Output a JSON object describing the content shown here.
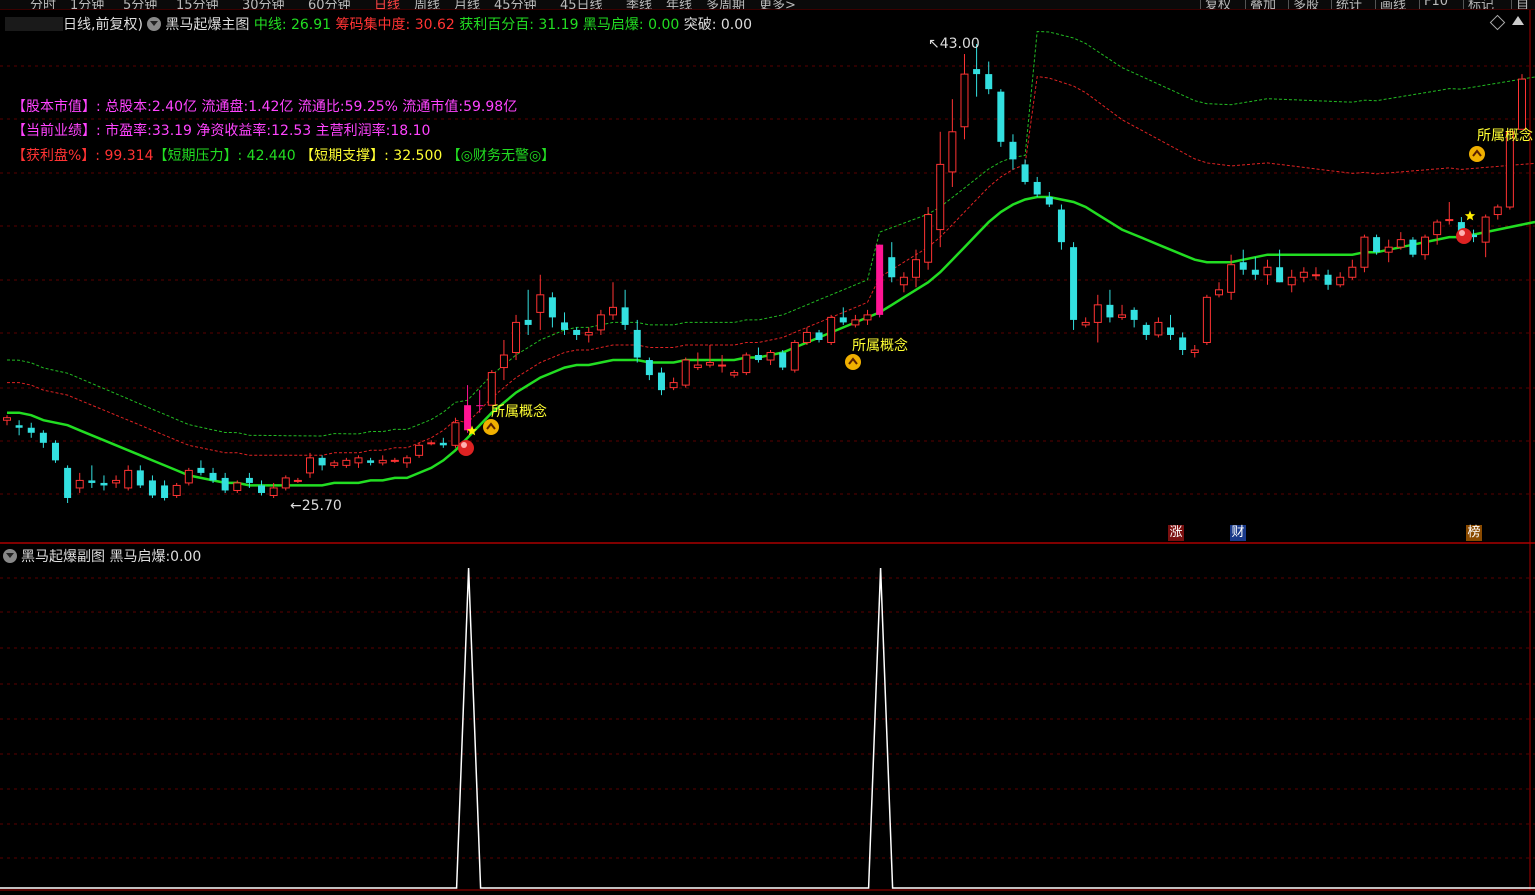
{
  "toolbar": {
    "timeframes": [
      "分时",
      "1分钟",
      "5分钟",
      "15分钟",
      "30分钟",
      "60分钟",
      "日线",
      "周线",
      "月线",
      "45分钟",
      "45日线",
      "季线",
      "年线",
      "多周期",
      "更多>"
    ],
    "active_timeframe": "日线",
    "buttons": [
      "复权",
      "叠加",
      "多股",
      "统计",
      "画线",
      "F10",
      "标记",
      "自"
    ]
  },
  "main_panel": {
    "mode_label": "日线,前复权)",
    "indicator_name": "黑马起爆主图",
    "params": [
      {
        "label": "中线:",
        "value": "26.91",
        "color": "#22dd22"
      },
      {
        "label": "筹码集中度:",
        "value": "30.62",
        "color": "#ff3333"
      },
      {
        "label": "获利百分百:",
        "value": "31.19",
        "color": "#22dd22"
      },
      {
        "label": "黑马启爆:",
        "value": "0.00",
        "color": "#22dd22"
      },
      {
        "label": "突破:",
        "value": "0.00",
        "color": "#dddddd"
      }
    ],
    "info_rows": [
      {
        "label": "【股本市值】:",
        "text": "总股本:2.40亿 流通盘:1.42亿 流通比:59.25% 流通市值:59.98亿",
        "color": "#ff44ff"
      },
      {
        "label": "【当前业绩】:",
        "text": "市盈率:33.19 净资收益率:12.53 主营利润率:18.10",
        "color": "#ff44ff"
      }
    ],
    "row3": {
      "profit_label": "【获利盘%】:",
      "profit_value": "99.314",
      "pressure_label": "【短期压力】:",
      "pressure_value": "42.440",
      "support_label": "【短期支撑】:",
      "support_value": "32.500",
      "finance_text": "【◎财务无警◎】"
    },
    "high_label": "43.00",
    "low_label": "25.70",
    "concept_label": "所属概念",
    "badges": [
      {
        "text": "涨",
        "color": "#cc2222"
      },
      {
        "text": "财",
        "color": "#2255cc"
      },
      {
        "text": "榜",
        "color": "#cc6600"
      }
    ]
  },
  "sub_panel": {
    "indicator_name": "黑马起爆副图",
    "param_label": "黑马启爆:",
    "param_value": "0.00"
  },
  "colors": {
    "up": "#ff3333",
    "down": "#33e0e0",
    "pink": "#ff1493",
    "mid_line": "#22dd22",
    "res_line": "#dd2222",
    "grid": "#5a0000"
  },
  "chart_data": [
    {
      "type": "candlestick",
      "title": "黑马起爆主图",
      "price_range": [
        25.7,
        43.0
      ],
      "candles": [
        {
          "o": 33.4,
          "h": 33.6,
          "l": 33.2,
          "c": 33.5
        },
        {
          "o": 33.2,
          "h": 33.4,
          "l": 32.8,
          "c": 33.1
        },
        {
          "o": 33.1,
          "h": 33.3,
          "l": 32.7,
          "c": 32.9
        },
        {
          "o": 32.9,
          "h": 33.0,
          "l": 32.3,
          "c": 32.5
        },
        {
          "o": 32.5,
          "h": 32.6,
          "l": 31.7,
          "c": 31.8
        },
        {
          "o": 31.5,
          "h": 31.6,
          "l": 30.1,
          "c": 30.3
        },
        {
          "o": 30.7,
          "h": 31.3,
          "l": 30.5,
          "c": 31.0
        },
        {
          "o": 31.0,
          "h": 31.6,
          "l": 30.7,
          "c": 30.9
        },
        {
          "o": 30.9,
          "h": 31.2,
          "l": 30.6,
          "c": 30.8
        },
        {
          "o": 30.9,
          "h": 31.2,
          "l": 30.7,
          "c": 31.0
        },
        {
          "o": 30.7,
          "h": 31.6,
          "l": 30.6,
          "c": 31.4
        },
        {
          "o": 31.4,
          "h": 31.6,
          "l": 30.7,
          "c": 30.8
        },
        {
          "o": 31.0,
          "h": 31.2,
          "l": 30.3,
          "c": 30.4
        },
        {
          "o": 30.8,
          "h": 31.0,
          "l": 30.2,
          "c": 30.3
        },
        {
          "o": 30.4,
          "h": 30.9,
          "l": 30.3,
          "c": 30.8
        },
        {
          "o": 30.9,
          "h": 31.5,
          "l": 30.8,
          "c": 31.4
        },
        {
          "o": 31.5,
          "h": 31.8,
          "l": 31.2,
          "c": 31.3
        },
        {
          "o": 31.3,
          "h": 31.5,
          "l": 30.9,
          "c": 31.0
        },
        {
          "o": 31.1,
          "h": 31.3,
          "l": 30.5,
          "c": 30.6
        },
        {
          "o": 30.6,
          "h": 31.0,
          "l": 30.5,
          "c": 30.9
        },
        {
          "o": 31.1,
          "h": 31.3,
          "l": 30.7,
          "c": 30.9
        },
        {
          "o": 30.8,
          "h": 31.0,
          "l": 30.4,
          "c": 30.5
        },
        {
          "o": 30.4,
          "h": 30.9,
          "l": 30.3,
          "c": 30.7
        },
        {
          "o": 30.7,
          "h": 31.2,
          "l": 30.6,
          "c": 31.1
        },
        {
          "o": 31.0,
          "h": 31.1,
          "l": 30.9,
          "c": 31.0
        },
        {
          "o": 31.3,
          "h": 32.1,
          "l": 31.1,
          "c": 31.9
        },
        {
          "o": 31.9,
          "h": 32.0,
          "l": 31.4,
          "c": 31.6
        },
        {
          "o": 31.6,
          "h": 31.8,
          "l": 31.5,
          "c": 31.7
        },
        {
          "o": 31.6,
          "h": 31.9,
          "l": 31.5,
          "c": 31.8
        },
        {
          "o": 31.7,
          "h": 32.0,
          "l": 31.5,
          "c": 31.9
        },
        {
          "o": 31.8,
          "h": 31.9,
          "l": 31.6,
          "c": 31.7
        },
        {
          "o": 31.7,
          "h": 32.0,
          "l": 31.6,
          "c": 31.8
        },
        {
          "o": 31.8,
          "h": 31.9,
          "l": 31.7,
          "c": 31.8
        },
        {
          "o": 31.7,
          "h": 32.0,
          "l": 31.5,
          "c": 31.9
        },
        {
          "o": 32.0,
          "h": 32.5,
          "l": 31.9,
          "c": 32.4
        },
        {
          "o": 32.5,
          "h": 32.6,
          "l": 32.4,
          "c": 32.5
        },
        {
          "o": 32.5,
          "h": 32.7,
          "l": 32.3,
          "c": 32.4
        },
        {
          "o": 32.4,
          "h": 33.5,
          "l": 32.3,
          "c": 33.3
        },
        {
          "o": 33.0,
          "h": 34.8,
          "l": 32.9,
          "c": 34.0
        },
        {
          "o": 34.0,
          "h": 34.6,
          "l": 33.7,
          "c": 34.0
        },
        {
          "o": 34.0,
          "h": 35.4,
          "l": 34.0,
          "c": 35.3
        },
        {
          "o": 35.5,
          "h": 36.6,
          "l": 35.0,
          "c": 36.0
        },
        {
          "o": 36.1,
          "h": 37.6,
          "l": 35.8,
          "c": 37.3
        },
        {
          "o": 37.4,
          "h": 38.6,
          "l": 36.8,
          "c": 37.2
        },
        {
          "o": 37.7,
          "h": 39.2,
          "l": 37.0,
          "c": 38.4
        },
        {
          "o": 38.3,
          "h": 38.5,
          "l": 37.1,
          "c": 37.5
        },
        {
          "o": 37.3,
          "h": 37.7,
          "l": 36.8,
          "c": 37.0
        },
        {
          "o": 37.0,
          "h": 37.1,
          "l": 36.6,
          "c": 36.8
        },
        {
          "o": 36.8,
          "h": 37.1,
          "l": 36.5,
          "c": 36.9
        },
        {
          "o": 37.0,
          "h": 37.8,
          "l": 36.8,
          "c": 37.6
        },
        {
          "o": 37.6,
          "h": 38.9,
          "l": 37.4,
          "c": 37.9
        },
        {
          "o": 37.9,
          "h": 38.6,
          "l": 37.0,
          "c": 37.2
        },
        {
          "o": 37.0,
          "h": 37.4,
          "l": 35.7,
          "c": 35.9
        },
        {
          "o": 35.8,
          "h": 35.9,
          "l": 35.0,
          "c": 35.2
        },
        {
          "o": 35.3,
          "h": 35.5,
          "l": 34.4,
          "c": 34.6
        },
        {
          "o": 34.7,
          "h": 35.1,
          "l": 34.6,
          "c": 34.9
        },
        {
          "o": 34.8,
          "h": 35.9,
          "l": 34.7,
          "c": 35.8
        },
        {
          "o": 35.5,
          "h": 36.1,
          "l": 35.4,
          "c": 35.6
        },
        {
          "o": 35.6,
          "h": 36.4,
          "l": 35.5,
          "c": 35.7
        },
        {
          "o": 35.6,
          "h": 36.0,
          "l": 35.3,
          "c": 35.6
        },
        {
          "o": 35.2,
          "h": 35.4,
          "l": 35.1,
          "c": 35.3
        },
        {
          "o": 35.3,
          "h": 36.1,
          "l": 35.2,
          "c": 36.0
        },
        {
          "o": 36.0,
          "h": 36.3,
          "l": 35.7,
          "c": 35.8
        },
        {
          "o": 35.8,
          "h": 36.2,
          "l": 35.6,
          "c": 36.1
        },
        {
          "o": 36.1,
          "h": 36.2,
          "l": 35.4,
          "c": 35.5
        },
        {
          "o": 35.4,
          "h": 36.6,
          "l": 35.3,
          "c": 36.5
        },
        {
          "o": 36.5,
          "h": 37.1,
          "l": 36.4,
          "c": 36.9
        },
        {
          "o": 36.9,
          "h": 37.0,
          "l": 36.5,
          "c": 36.6
        },
        {
          "o": 36.5,
          "h": 37.6,
          "l": 36.4,
          "c": 37.5
        },
        {
          "o": 37.5,
          "h": 37.9,
          "l": 37.2,
          "c": 37.3
        },
        {
          "o": 37.2,
          "h": 37.6,
          "l": 37.1,
          "c": 37.4
        },
        {
          "o": 37.4,
          "h": 37.8,
          "l": 37.2,
          "c": 37.6
        },
        {
          "o": 37.6,
          "h": 40.4,
          "l": 37.5,
          "c": 40.4
        },
        {
          "o": 39.9,
          "h": 40.5,
          "l": 38.9,
          "c": 39.1
        },
        {
          "o": 38.8,
          "h": 39.3,
          "l": 38.5,
          "c": 39.1
        },
        {
          "o": 39.1,
          "h": 40.2,
          "l": 38.7,
          "c": 39.8
        },
        {
          "o": 39.7,
          "h": 41.9,
          "l": 39.4,
          "c": 41.6
        },
        {
          "o": 41.0,
          "h": 44.9,
          "l": 40.3,
          "c": 43.6
        },
        {
          "o": 43.3,
          "h": 46.2,
          "l": 42.7,
          "c": 44.9
        },
        {
          "o": 45.1,
          "h": 48.0,
          "l": 44.6,
          "c": 47.2
        },
        {
          "o": 47.4,
          "h": 48.4,
          "l": 46.3,
          "c": 47.2
        },
        {
          "o": 47.2,
          "h": 47.7,
          "l": 46.4,
          "c": 46.6
        },
        {
          "o": 46.5,
          "h": 46.6,
          "l": 44.3,
          "c": 44.5
        },
        {
          "o": 44.5,
          "h": 44.8,
          "l": 43.4,
          "c": 43.8
        },
        {
          "o": 43.6,
          "h": 43.8,
          "l": 42.8,
          "c": 42.9
        },
        {
          "o": 42.9,
          "h": 43.1,
          "l": 42.3,
          "c": 42.4
        },
        {
          "o": 42.3,
          "h": 42.5,
          "l": 41.9,
          "c": 42.0
        },
        {
          "o": 41.8,
          "h": 42.0,
          "l": 40.2,
          "c": 40.5
        },
        {
          "o": 40.3,
          "h": 40.5,
          "l": 37.0,
          "c": 37.4
        },
        {
          "o": 37.2,
          "h": 37.5,
          "l": 37.1,
          "c": 37.3
        },
        {
          "o": 37.3,
          "h": 38.4,
          "l": 36.5,
          "c": 38.0
        },
        {
          "o": 38.0,
          "h": 38.6,
          "l": 37.3,
          "c": 37.5
        },
        {
          "o": 37.5,
          "h": 38.0,
          "l": 37.4,
          "c": 37.6
        },
        {
          "o": 37.8,
          "h": 37.9,
          "l": 37.1,
          "c": 37.4
        },
        {
          "o": 37.2,
          "h": 37.3,
          "l": 36.6,
          "c": 36.8
        },
        {
          "o": 36.8,
          "h": 37.5,
          "l": 36.7,
          "c": 37.3
        },
        {
          "o": 37.1,
          "h": 37.6,
          "l": 36.6,
          "c": 36.8
        },
        {
          "o": 36.7,
          "h": 36.9,
          "l": 36.0,
          "c": 36.2
        },
        {
          "o": 36.1,
          "h": 36.4,
          "l": 35.9,
          "c": 36.2
        },
        {
          "o": 36.5,
          "h": 38.4,
          "l": 36.4,
          "c": 38.3
        },
        {
          "o": 38.4,
          "h": 38.9,
          "l": 38.3,
          "c": 38.6
        },
        {
          "o": 38.5,
          "h": 40.0,
          "l": 38.2,
          "c": 39.6
        },
        {
          "o": 39.7,
          "h": 40.2,
          "l": 39.2,
          "c": 39.4
        },
        {
          "o": 39.4,
          "h": 39.9,
          "l": 39.0,
          "c": 39.2
        },
        {
          "o": 39.2,
          "h": 39.8,
          "l": 38.8,
          "c": 39.5
        },
        {
          "o": 39.5,
          "h": 40.2,
          "l": 38.9,
          "c": 38.9
        },
        {
          "o": 38.8,
          "h": 39.4,
          "l": 38.5,
          "c": 39.1
        },
        {
          "o": 39.1,
          "h": 39.5,
          "l": 38.9,
          "c": 39.3
        },
        {
          "o": 39.2,
          "h": 39.5,
          "l": 39.0,
          "c": 39.2
        },
        {
          "o": 39.2,
          "h": 39.4,
          "l": 38.6,
          "c": 38.8
        },
        {
          "o": 38.8,
          "h": 39.3,
          "l": 38.7,
          "c": 39.1
        },
        {
          "o": 39.1,
          "h": 39.8,
          "l": 39.0,
          "c": 39.5
        },
        {
          "o": 39.5,
          "h": 40.8,
          "l": 39.3,
          "c": 40.7
        },
        {
          "o": 40.7,
          "h": 40.8,
          "l": 40.0,
          "c": 40.1
        },
        {
          "o": 40.1,
          "h": 40.6,
          "l": 39.7,
          "c": 40.3
        },
        {
          "o": 40.3,
          "h": 40.9,
          "l": 40.2,
          "c": 40.6
        },
        {
          "o": 40.6,
          "h": 40.7,
          "l": 39.9,
          "c": 40.0
        },
        {
          "o": 40.0,
          "h": 40.8,
          "l": 39.8,
          "c": 40.7
        },
        {
          "o": 40.8,
          "h": 41.4,
          "l": 40.4,
          "c": 41.3
        },
        {
          "o": 41.4,
          "h": 42.1,
          "l": 41.2,
          "c": 41.4
        },
        {
          "o": 41.3,
          "h": 41.5,
          "l": 40.6,
          "c": 40.8
        },
        {
          "o": 40.8,
          "h": 41.0,
          "l": 40.5,
          "c": 40.7
        },
        {
          "o": 40.5,
          "h": 41.6,
          "l": 39.9,
          "c": 41.5
        },
        {
          "o": 41.6,
          "h": 42.0,
          "l": 41.4,
          "c": 41.9
        },
        {
          "o": 41.9,
          "h": 45.0,
          "l": 41.8,
          "c": 44.9
        },
        {
          "o": 45.0,
          "h": 47.2,
          "l": 45.0,
          "c": 47.0
        }
      ],
      "pink_candles": [
        38,
        39,
        72,
        129,
        130
      ],
      "mid_line": [
        33.7,
        33.7,
        33.6,
        33.4,
        33.3,
        33.2,
        33.0,
        32.8,
        32.6,
        32.4,
        32.2,
        32.0,
        31.8,
        31.6,
        31.4,
        31.2,
        31.1,
        31.0,
        30.9,
        30.9,
        30.8,
        30.8,
        30.8,
        30.8,
        30.8,
        30.8,
        30.8,
        30.9,
        30.9,
        30.9,
        31.0,
        31.0,
        31.1,
        31.1,
        31.3,
        31.5,
        31.8,
        32.2,
        32.7,
        33.2,
        33.7,
        34.1,
        34.5,
        34.8,
        35.1,
        35.3,
        35.5,
        35.6,
        35.6,
        35.7,
        35.8,
        35.8,
        35.8,
        35.7,
        35.7,
        35.7,
        35.8,
        35.8,
        35.8,
        35.8,
        35.8,
        35.9,
        35.9,
        36.0,
        36.1,
        36.3,
        36.5,
        36.7,
        36.9,
        37.1,
        37.3,
        37.5,
        37.7,
        38.0,
        38.3,
        38.6,
        38.9,
        39.3,
        39.8,
        40.3,
        40.8,
        41.3,
        41.7,
        42.0,
        42.2,
        42.3,
        42.3,
        42.2,
        42.1,
        41.9,
        41.6,
        41.3,
        41.0,
        40.8,
        40.6,
        40.4,
        40.2,
        40.0,
        39.8,
        39.7,
        39.7,
        39.7,
        39.8,
        39.9,
        40.0,
        40.0,
        40.0,
        40.0,
        40.0,
        40.0,
        40.0,
        40.0,
        40.1,
        40.1,
        40.2,
        40.3,
        40.4,
        40.5,
        40.6,
        40.7,
        40.7,
        40.8,
        40.9,
        41.0,
        41.1,
        41.2,
        41.3,
        41.3,
        41.4,
        41.5,
        41.9
      ]
    },
    {
      "type": "line",
      "title": "黑马起爆副图",
      "spike_indices": [
        38,
        72,
        129
      ]
    }
  ]
}
